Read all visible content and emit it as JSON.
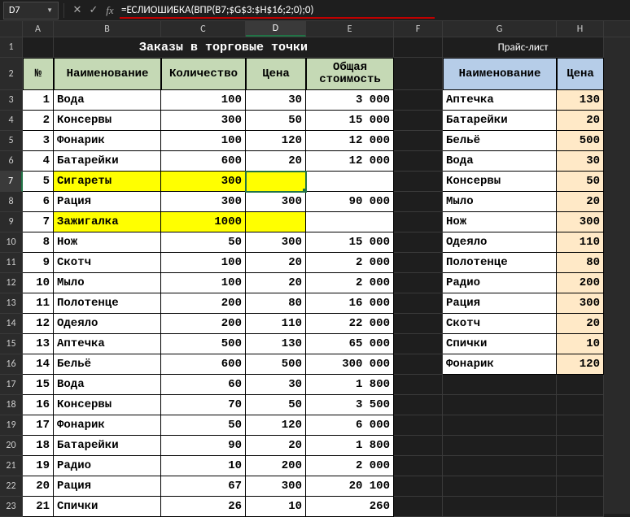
{
  "cellref": "D7",
  "formula": "=ЕСЛИОШИБКА(ВПР(B7;$G$3:$H$16;2;0);0)",
  "columns": [
    "A",
    "B",
    "C",
    "D",
    "E",
    "F",
    "G",
    "H"
  ],
  "titles": {
    "left": "Заказы в торговые точки",
    "right": "Прайс-лист"
  },
  "orders": {
    "headers": {
      "num": "№",
      "name": "Наименование",
      "qty": "Количество",
      "price": "Цена",
      "total": "Общая стоимость"
    },
    "rows": [
      {
        "n": "1",
        "name": "Вода",
        "qty": "100",
        "price": "30",
        "total": "3 000"
      },
      {
        "n": "2",
        "name": "Консервы",
        "qty": "300",
        "price": "50",
        "total": "15 000"
      },
      {
        "n": "3",
        "name": "Фонарик",
        "qty": "100",
        "price": "120",
        "total": "12 000"
      },
      {
        "n": "4",
        "name": "Батарейки",
        "qty": "600",
        "price": "20",
        "total": "12 000"
      },
      {
        "n": "5",
        "name": "Сигареты",
        "qty": "300",
        "price": "",
        "total": "",
        "hl": true
      },
      {
        "n": "6",
        "name": "Рация",
        "qty": "300",
        "price": "300",
        "total": "90 000"
      },
      {
        "n": "7",
        "name": "Зажигалка",
        "qty": "1000",
        "price": "",
        "total": "",
        "hl": true
      },
      {
        "n": "8",
        "name": "Нож",
        "qty": "50",
        "price": "300",
        "total": "15 000"
      },
      {
        "n": "9",
        "name": "Скотч",
        "qty": "100",
        "price": "20",
        "total": "2 000"
      },
      {
        "n": "10",
        "name": "Мыло",
        "qty": "100",
        "price": "20",
        "total": "2 000"
      },
      {
        "n": "11",
        "name": "Полотенце",
        "qty": "200",
        "price": "80",
        "total": "16 000"
      },
      {
        "n": "12",
        "name": "Одеяло",
        "qty": "200",
        "price": "110",
        "total": "22 000"
      },
      {
        "n": "13",
        "name": "Аптечка",
        "qty": "500",
        "price": "130",
        "total": "65 000"
      },
      {
        "n": "14",
        "name": "Бельё",
        "qty": "600",
        "price": "500",
        "total": "300 000"
      },
      {
        "n": "15",
        "name": "Вода",
        "qty": "60",
        "price": "30",
        "total": "1 800"
      },
      {
        "n": "16",
        "name": "Консервы",
        "qty": "70",
        "price": "50",
        "total": "3 500"
      },
      {
        "n": "17",
        "name": "Фонарик",
        "qty": "50",
        "price": "120",
        "total": "6 000"
      },
      {
        "n": "18",
        "name": "Батарейки",
        "qty": "90",
        "price": "20",
        "total": "1 800"
      },
      {
        "n": "19",
        "name": "Радио",
        "qty": "10",
        "price": "200",
        "total": "2 000"
      },
      {
        "n": "20",
        "name": "Рация",
        "qty": "67",
        "price": "300",
        "total": "20 100"
      },
      {
        "n": "21",
        "name": "Спички",
        "qty": "26",
        "price": "10",
        "total": "260"
      }
    ]
  },
  "pricelist": {
    "headers": {
      "name": "Наименование",
      "price": "Цена"
    },
    "rows": [
      {
        "name": "Аптечка",
        "price": "130"
      },
      {
        "name": "Батарейки",
        "price": "20"
      },
      {
        "name": "Бельё",
        "price": "500"
      },
      {
        "name": "Вода",
        "price": "30"
      },
      {
        "name": "Консервы",
        "price": "50"
      },
      {
        "name": "Мыло",
        "price": "20"
      },
      {
        "name": "Нож",
        "price": "300"
      },
      {
        "name": "Одеяло",
        "price": "110"
      },
      {
        "name": "Полотенце",
        "price": "80"
      },
      {
        "name": "Радио",
        "price": "200"
      },
      {
        "name": "Рация",
        "price": "300"
      },
      {
        "name": "Скотч",
        "price": "20"
      },
      {
        "name": "Спички",
        "price": "10"
      },
      {
        "name": "Фонарик",
        "price": "120"
      }
    ]
  },
  "selected_row": 7,
  "selected_col": "D"
}
